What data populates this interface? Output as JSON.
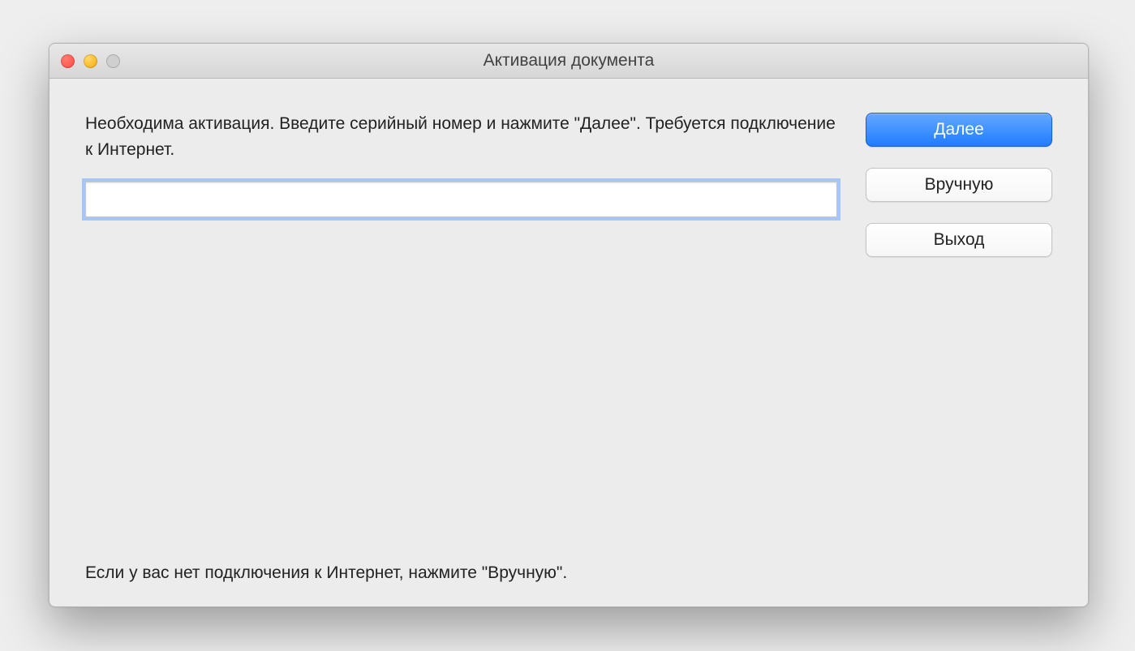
{
  "window": {
    "title": "Активация документа"
  },
  "instructions": "Необходима активация. Введите серийный номер и нажмите \"Далее\". Требуется подключение к Интернет.",
  "serial": {
    "value": "",
    "placeholder": ""
  },
  "hint": "Если у вас нет подключения к Интернет, нажмите \"Вручную\".",
  "buttons": {
    "next": "Далее",
    "manual": "Вручную",
    "exit": "Выход"
  }
}
